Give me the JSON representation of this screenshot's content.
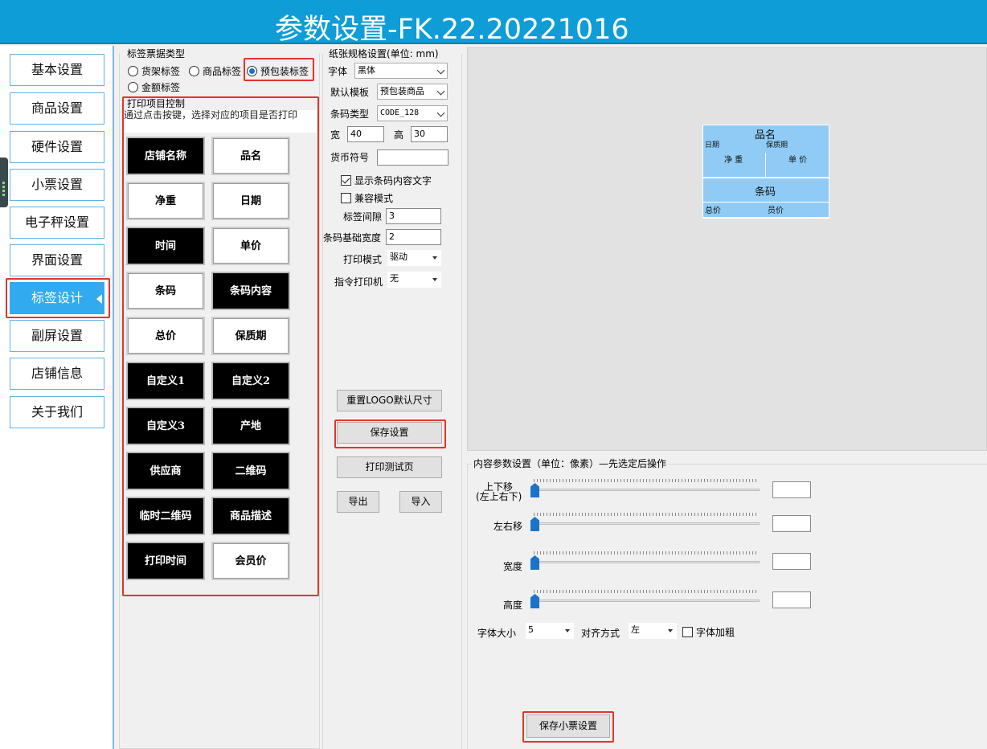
{
  "window": {
    "title": "参数设置-FK.22.20221016"
  },
  "sidebar": {
    "items": [
      {
        "label": "基本设置"
      },
      {
        "label": "商品设置"
      },
      {
        "label": "硬件设置"
      },
      {
        "label": "小票设置"
      },
      {
        "label": "电子秤设置"
      },
      {
        "label": "界面设置"
      },
      {
        "label": "标签设计",
        "active": true
      },
      {
        "label": "副屏设置"
      },
      {
        "label": "店铺信息"
      },
      {
        "label": "关于我们"
      }
    ]
  },
  "label_type": {
    "group_title": "标签票据类型",
    "options": [
      {
        "label": "货架标签",
        "checked": false
      },
      {
        "label": "商品标签",
        "checked": false
      },
      {
        "label": "预包装标签",
        "checked": true
      },
      {
        "label": "金额标签",
        "checked": false
      }
    ]
  },
  "print_control": {
    "group_title": "打印项目控制",
    "hint": "通过点击按键，选择对应的项目是否打印",
    "buttons": [
      {
        "label": "店铺名称",
        "on": true
      },
      {
        "label": "品名",
        "on": false
      },
      {
        "label": "净重",
        "on": false
      },
      {
        "label": "日期",
        "on": false
      },
      {
        "label": "时间",
        "on": true
      },
      {
        "label": "单价",
        "on": false
      },
      {
        "label": "条码",
        "on": false
      },
      {
        "label": "条码内容",
        "on": true
      },
      {
        "label": "总价",
        "on": false
      },
      {
        "label": "保质期",
        "on": false
      },
      {
        "label": "自定义1",
        "on": true
      },
      {
        "label": "自定义2",
        "on": true
      },
      {
        "label": "自定义3",
        "on": true
      },
      {
        "label": "产地",
        "on": true
      },
      {
        "label": "供应商",
        "on": true
      },
      {
        "label": "二维码",
        "on": true
      },
      {
        "label": "临时二维码",
        "on": true
      },
      {
        "label": "商品描述",
        "on": true
      },
      {
        "label": "打印时间",
        "on": true
      },
      {
        "label": "会员价",
        "on": false
      }
    ]
  },
  "paper": {
    "group_title": "纸张规格设置(单位: mm)",
    "font_label": "字体",
    "font_value": "黑体",
    "template_label": "默认模板",
    "template_value": "预包装商品",
    "barcode_type_label": "条码类型",
    "barcode_type_value": "CODE_128",
    "width_label": "宽",
    "width_value": "40",
    "height_label": "高",
    "height_value": "30",
    "currency_label": "货币符号",
    "currency_value": "",
    "show_barcode_text": {
      "label": "显示条码内容文字",
      "checked": true
    },
    "compat_mode": {
      "label": "兼容模式",
      "checked": false
    },
    "gap_label": "标签间隙",
    "gap_value": "3",
    "barcode_width_label": "条码基础宽度",
    "barcode_width_value": "2",
    "print_mode_label": "打印模式",
    "print_mode_value": "驱动",
    "cmd_printer_label": "指令打印机",
    "cmd_printer_value": "无",
    "reset_logo_btn": "重置LOGO默认尺寸",
    "save_btn": "保存设置",
    "print_test_btn": "打印测试页",
    "export_btn": "导出",
    "import_btn": "导入"
  },
  "preview": {
    "cells": {
      "name": "品名",
      "date": "日期",
      "shelf_life": "保质期",
      "net_weight": "净 重",
      "unit_price": "单 价",
      "barcode": "条码",
      "total_price": "总价",
      "member_price": "员价"
    }
  },
  "content_params": {
    "group_title": "内容参数设置（单位：像素）—先选定后操作",
    "updown_label": "上下移",
    "updown_sub": "(左上右下)",
    "leftright_label": "左右移",
    "width_label": "宽度",
    "height_label": "高度",
    "updown_level": 0,
    "leftright_level": 0,
    "width_level": 0,
    "height_level": 0,
    "font_size_label": "字体大小",
    "font_size_value": "5",
    "align_label": "对齐方式",
    "align_value": "左",
    "bold": {
      "label": "字体加粗",
      "checked": false
    },
    "save_receipt_btn": "保存小票设置"
  }
}
